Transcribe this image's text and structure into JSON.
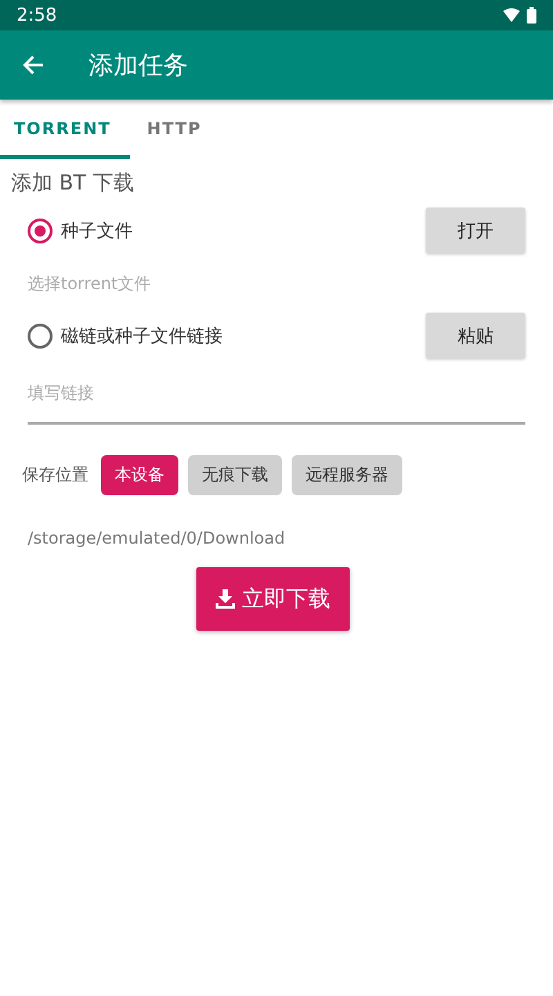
{
  "status_bar": {
    "time": "2:58"
  },
  "app_bar": {
    "title": "添加任务"
  },
  "tabs": [
    {
      "label": "TORRENT",
      "selected": true
    },
    {
      "label": "HTTP",
      "selected": false
    }
  ],
  "section_title": "添加 BT 下载",
  "sources": [
    {
      "label": "种子文件",
      "selected": true,
      "button": "打开",
      "hint": {
        "kind": "label",
        "text": "选择torrent文件"
      }
    },
    {
      "label": "磁链或种子文件链接",
      "selected": false,
      "button": "粘贴",
      "hint": {
        "kind": "field",
        "placeholder": "填写链接"
      }
    }
  ],
  "save_location": {
    "label": "保存位置",
    "options": [
      {
        "label": "本设备",
        "selected": true
      },
      {
        "label": "无痕下载",
        "selected": false
      },
      {
        "label": "远程服务器",
        "selected": false
      }
    ],
    "path": "/storage/emulated/0/Download"
  },
  "download_button": "立即下载"
}
